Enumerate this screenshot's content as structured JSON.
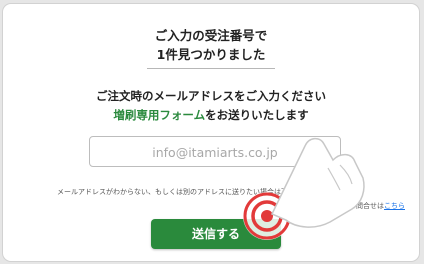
{
  "header": {
    "line1": "ご入力の受注番号で",
    "line2": "1件見つかりました"
  },
  "instructions": {
    "line1": "ご注文時のメールアドレスをご入力ください",
    "line2_green": "増刷専用フォーム",
    "line2_rest": "をお送りいたします"
  },
  "email_input": {
    "placeholder": "info@itamiarts.co.jp"
  },
  "note": {
    "text": "メールアドレスがわからない、もしくは別のアドレスに送りたい場合は下記までご連絡ください。",
    "contact_prefix": "お問合せは",
    "contact_link": "こちら"
  },
  "submit_button": {
    "label": "送信する"
  },
  "colors": {
    "accent_green": "#2a8a3c",
    "link_blue": "#1a73e8",
    "tap_indicator": "#e23a3a"
  },
  "icons": [
    "pointing-hand-icon",
    "tap-target-icon"
  ]
}
